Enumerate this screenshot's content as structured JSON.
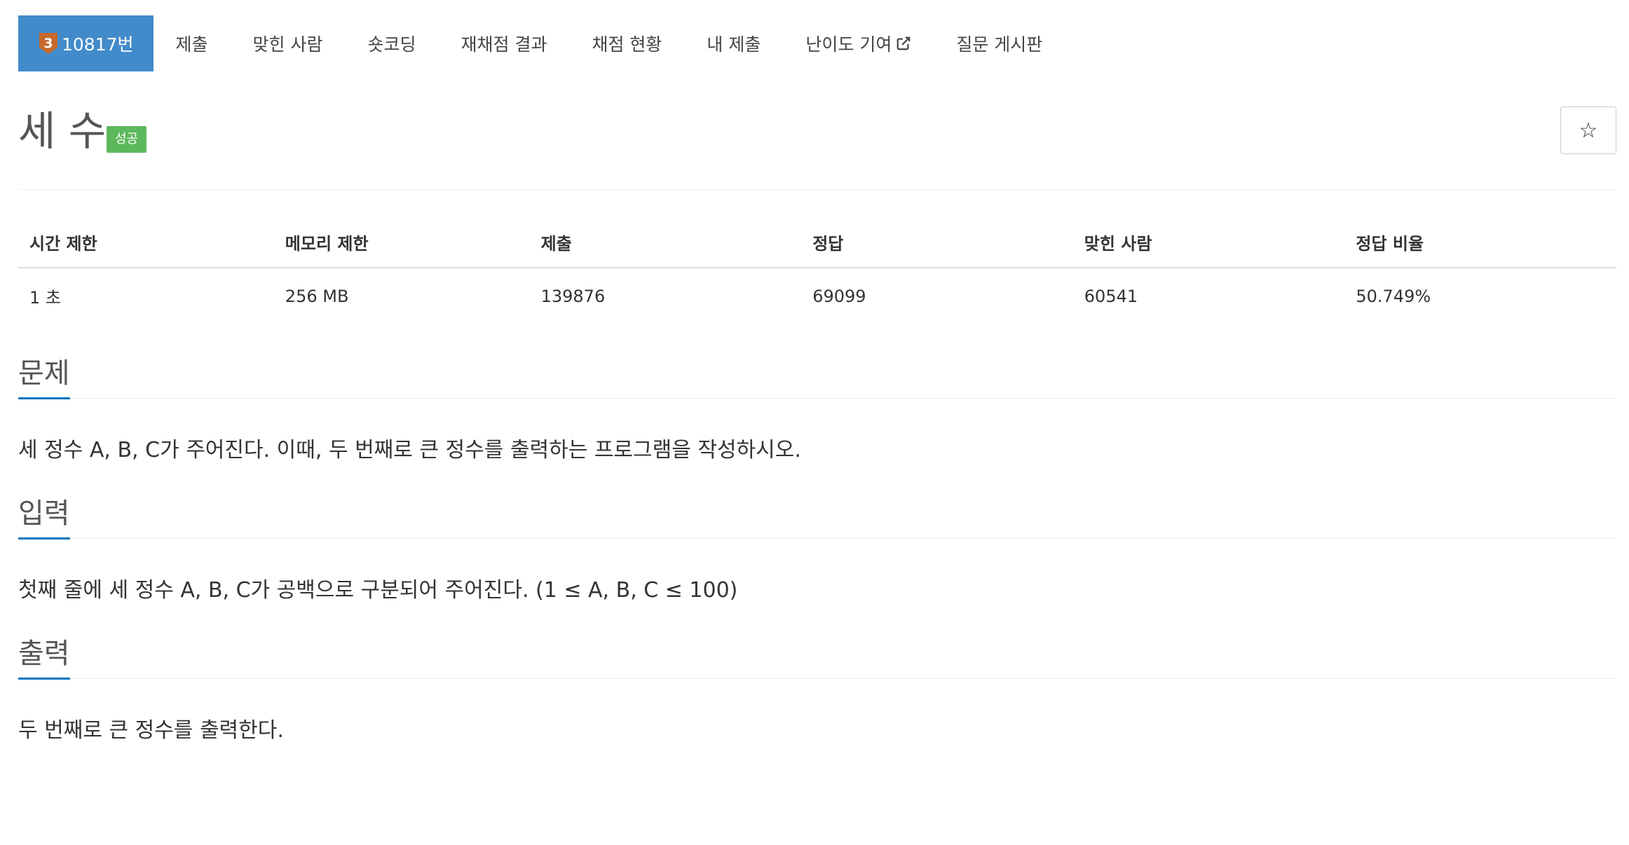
{
  "nav": {
    "problem_tier": "3",
    "problem_number": "10817번",
    "items": [
      "제출",
      "맞힌 사람",
      "숏코딩",
      "재채점 결과",
      "채점 현황",
      "내 제출",
      "난이도 기여",
      "질문 게시판"
    ]
  },
  "problem": {
    "title": "세 수",
    "status_badge": "성공",
    "star_icon": "☆"
  },
  "info_table": {
    "headers": [
      "시간 제한",
      "메모리 제한",
      "제출",
      "정답",
      "맞힌 사람",
      "정답 비율"
    ],
    "row": [
      "1 초",
      "256 MB",
      "139876",
      "69099",
      "60541",
      "50.749%"
    ]
  },
  "sections": [
    {
      "title": "문제",
      "text": "세 정수 A, B, C가 주어진다. 이때, 두 번째로 큰 정수를 출력하는 프로그램을 작성하시오."
    },
    {
      "title": "입력",
      "text": "첫째 줄에 세 정수 A, B, C가 공백으로 구분되어 주어진다. (1 ≤ A, B, C ≤ 100)"
    },
    {
      "title": "출력",
      "text": "두 번째로 큰 정수를 출력한다."
    }
  ],
  "colors": {
    "active_tab": "#428bca",
    "success_badge": "#5cb85c",
    "section_underline": "#0076c0",
    "tier_bronze": "#c56a2c"
  }
}
